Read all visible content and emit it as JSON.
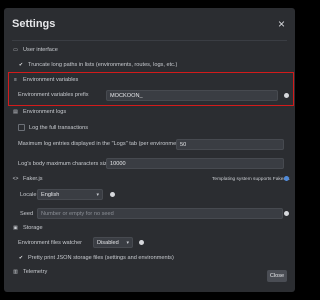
{
  "dialog": {
    "title": "Settings",
    "close_label": "Close"
  },
  "ui": {
    "section_title": "User interface",
    "truncate_label": "Truncate long paths in lists (environments, routes, logs, etc.)"
  },
  "env_vars": {
    "section_title": "Environment variables",
    "prefix_label": "Environment variables prefix",
    "prefix_value": "MOCKOON_"
  },
  "logs": {
    "section_title": "Environment logs",
    "log_full_label": "Log the full transactions",
    "max_entries_label": "Maximum log entries displayed in the \"Logs\" tab (per environment)",
    "max_entries_value": "50",
    "max_body_label": "Log's body maximum characters size",
    "max_body_value": "10000"
  },
  "faker": {
    "section_title": "Faker.js",
    "templating_note": "Templating system supports Faker.js",
    "locale_label": "Locale",
    "locale_value": "English",
    "seed_label": "Seed",
    "seed_placeholder": "Number or empty for no seed"
  },
  "storage": {
    "section_title": "Storage",
    "watcher_label": "Environment files watcher",
    "watcher_value": "Disabled",
    "pretty_print_label": "Pretty print JSON storage files (settings and environments)"
  },
  "telemetry": {
    "section_title": "Telemetry"
  },
  "colors": {
    "highlight": "#d31b1b",
    "info_blue": "#4f8ad9"
  }
}
